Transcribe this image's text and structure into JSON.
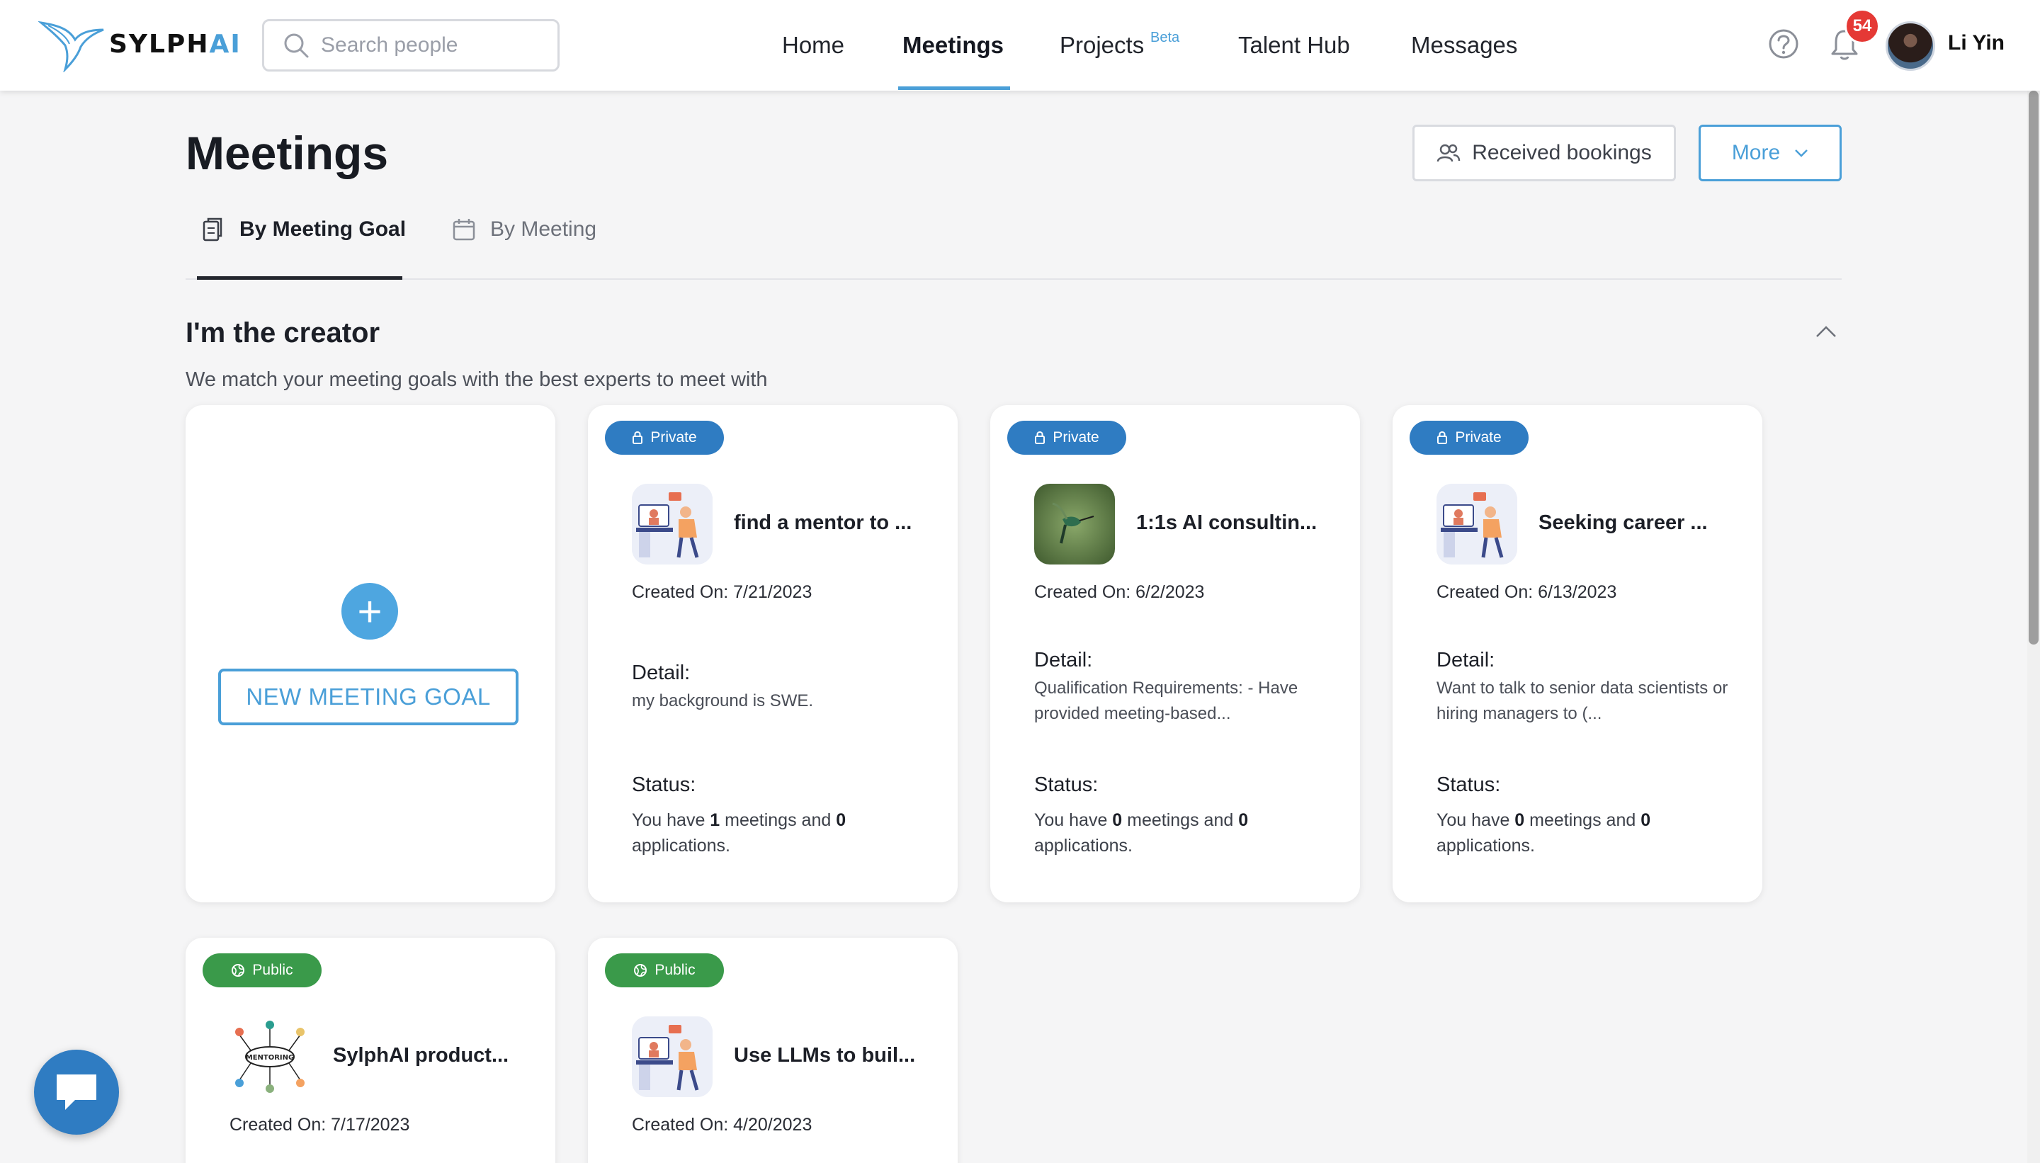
{
  "header": {
    "logo_text": "SYLPH",
    "logo_text_ai": "AI",
    "search_placeholder": "Search people",
    "nav": [
      {
        "label": "Home",
        "active": false
      },
      {
        "label": "Meetings",
        "active": true
      },
      {
        "label": "Projects",
        "active": false
      },
      {
        "label": "Talent Hub",
        "active": false
      },
      {
        "label": "Messages",
        "active": false
      }
    ],
    "projects_badge": "Beta",
    "notification_count": "54",
    "user_name": "Li Yin"
  },
  "page": {
    "title": "Meetings",
    "received_bookings": "Received bookings",
    "more": "More",
    "tabs": [
      {
        "label": "By Meeting Goal",
        "active": true
      },
      {
        "label": "By Meeting",
        "active": false
      }
    ]
  },
  "section": {
    "title": "I'm the creator",
    "subtitle": "We match your meeting goals with the best experts to meet with",
    "new_goal_label": "NEW MEETING GOAL",
    "detail_label": "Detail:",
    "status_label": "Status:",
    "status_prefix": "You have ",
    "status_mid": " meetings and ",
    "status_suffix": " applications."
  },
  "cards": [
    {
      "visibility": "Private",
      "name": "find a mentor to ...",
      "created": "Created On: 7/21/2023",
      "detail": "my background is SWE.",
      "meetings": "1",
      "applications": "0",
      "thumb": "video-call-illustration"
    },
    {
      "visibility": "Private",
      "name": "1:1s AI consultin...",
      "created": "Created On: 6/2/2023",
      "detail": "Qualification Requirements: - Have provided meeting-based...",
      "meetings": "0",
      "applications": "0",
      "thumb": "hummingbird-photo"
    },
    {
      "visibility": "Private",
      "name": "Seeking career ...",
      "created": "Created On: 6/13/2023",
      "detail": "Want to talk to senior data scientists or hiring managers to (...",
      "meetings": "0",
      "applications": "0",
      "thumb": "video-call-illustration"
    },
    {
      "visibility": "Public",
      "name": "SylphAI product...",
      "created": "Created On: 7/17/2023",
      "thumb": "mentoring-mindmap"
    },
    {
      "visibility": "Public",
      "name": "Use LLMs to buil...",
      "created": "Created On: 4/20/2023",
      "thumb": "video-call-illustration"
    }
  ],
  "colors": {
    "accent": "#4a9fd8",
    "private_badge": "#2f7cc2",
    "public_badge": "#3a9a4a",
    "notification": "#e53935"
  }
}
